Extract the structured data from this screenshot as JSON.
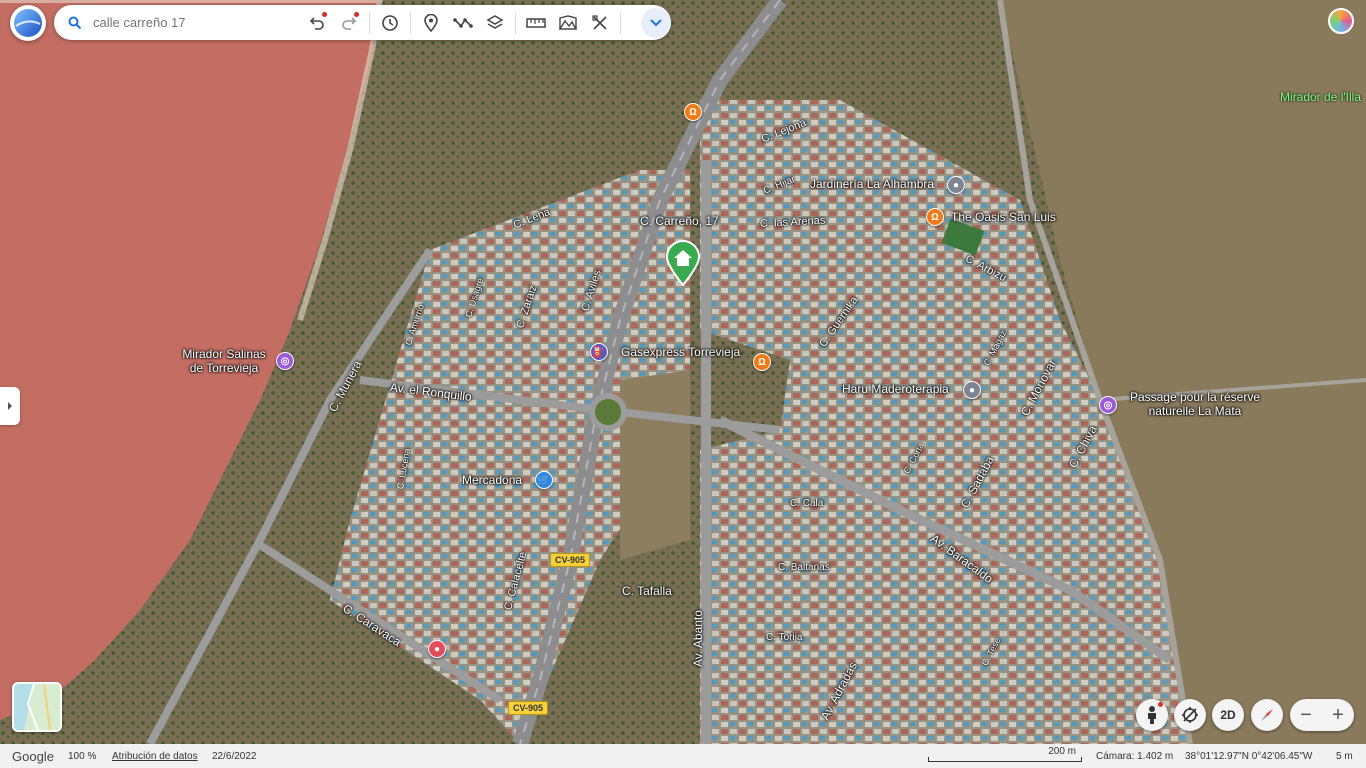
{
  "search": {
    "placeholder": "calle carreño 17"
  },
  "toolbar": {
    "buttons": [
      "undo-icon",
      "redo-icon",
      "history-icon",
      "placemark-icon",
      "path-icon",
      "layers-icon",
      "ruler-icon",
      "overlay-icon",
      "measure-icon",
      "chevron-down-icon"
    ]
  },
  "map": {
    "selected_place": "C. Carreño, 17",
    "streets": [
      "C. Lejona",
      "C. Hijar",
      "C. Lena",
      "C. las Arenas",
      "C. Arbizu",
      "C. Guernika",
      "C. Aviles",
      "C. Zaraiz",
      "C. Usagre",
      "C. Amurrio",
      "C. Munera",
      "Av. el Ronquillo",
      "C. Lucena",
      "C. Calacelte",
      "C. Caravaca",
      "C. Tafalla",
      "Av. Abanto",
      "C. Cala",
      "C. Baltanas",
      "C. Torija",
      "Av. Adradas",
      "Av. Baracaldo",
      "C. Sadaba",
      "C. Corta",
      "C. Monovar",
      "C. Chiva",
      "C. Magaz",
      "C. Tese"
    ],
    "places": {
      "mirador_illa": "Mirador de l'Illa",
      "jardineria": "Jardinería La Alhambra",
      "oasis": "The Oasis San Luis",
      "mirador_salinas": "Mirador Salinas de Torrevieja",
      "gasexpress": "Gasexpress Torrevieja",
      "haru": "Haru Maderoterapia",
      "passage": "Passage pour la réserve naturelle La Mata",
      "mercadona": "Mercadona"
    },
    "road_shields": [
      "CV-905",
      "CV-905"
    ]
  },
  "controls": {
    "view_mode": "2D"
  },
  "status": {
    "brand": "Google",
    "zoom": "100 %",
    "attribution": "Atribución de datos",
    "date": "22/6/2022",
    "scale": "200 m",
    "camera": "Cámara: 1.402 m",
    "coordinates": "38°01'12.97\"N 0°42'06.45\"W",
    "altitude": "5 m"
  },
  "colors": {
    "salt_lake": "#c46e63",
    "brand_blue": "#1a73e8",
    "home_pin": "#3aaa50"
  }
}
